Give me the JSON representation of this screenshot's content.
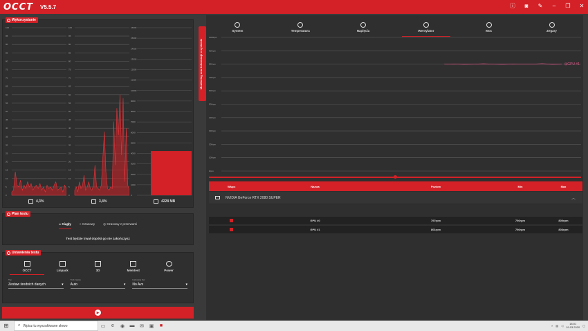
{
  "app": {
    "logo": "OCCT",
    "version": "V5.5.7"
  },
  "titlebar_icons": [
    "info-icon",
    "camera-icon",
    "wrench-icon",
    "minimize-icon",
    "restore-icon",
    "close-icon"
  ],
  "usage_panel": {
    "title": "Wykorzystanie",
    "cpu": {
      "value": "4,3%",
      "axis_ticks": [
        "100",
        "95",
        "90",
        "85",
        "80",
        "75",
        "70",
        "65",
        "60",
        "55",
        "50",
        "45",
        "40",
        "35",
        "30",
        "25",
        "20",
        "15",
        "10",
        "5",
        "0"
      ]
    },
    "gpu": {
      "value": "3,4%",
      "axis_ticks": [
        "100",
        "95",
        "90",
        "85",
        "80",
        "75",
        "70",
        "65",
        "60",
        "55",
        "50",
        "45",
        "40",
        "35",
        "30",
        "25",
        "20",
        "15",
        "10",
        "5",
        "0"
      ]
    },
    "ram": {
      "value": "4228 MB",
      "axis_ticks": [
        "16000",
        "15000",
        "14000",
        "13000",
        "12000",
        "11000",
        "10000",
        "9000",
        "8000",
        "7000",
        "6000",
        "5000",
        "4000",
        "3000",
        "2000",
        "1000",
        "0"
      ]
    }
  },
  "plan_panel": {
    "title": "Plan testu",
    "modes": [
      "Ciągły",
      "Czasowy",
      "Czasowy z przerwami"
    ],
    "active_mode": 0,
    "info": "Test będzie trwał dopóki go nie zakończysz"
  },
  "settings_panel": {
    "title": "Ustawienia testu",
    "tests": [
      "OCCT",
      "Linpack",
      "3D",
      "Memtest",
      "Power"
    ],
    "active_test": 0,
    "fields": [
      {
        "label": "Typ",
        "value": "Zestaw średnich danych"
      },
      {
        "label": "Tryb zapisu",
        "value": "Auto"
      },
      {
        "label": "Instrukcje Set",
        "value": "No Avx"
      }
    ]
  },
  "side_tab": "Monitoring oraz informacje o systemie",
  "monitor": {
    "tabs": [
      "System",
      "Temperatura",
      "Napięcia",
      "Wentylator",
      "Moc",
      "Zegary"
    ],
    "active_tab": 3,
    "legend": "GPU #1",
    "axis_ticks": [
      "1000rpm",
      "900rpm",
      "800rpm",
      "700rpm",
      "600rpm",
      "500rpm",
      "400rpm",
      "300rpm",
      "200rpm",
      "100rpm",
      "0rpm"
    ]
  },
  "chart_data": {
    "type": "line",
    "title": "",
    "xlabel": "",
    "ylabel": "",
    "ylim": [
      0,
      1000
    ],
    "series": [
      {
        "name": "GPU #1",
        "values": [
          800,
          801,
          799,
          800,
          802,
          800,
          799,
          801,
          800,
          800,
          803,
          799,
          800
        ]
      }
    ]
  },
  "table": {
    "headers": [
      "Włącz",
      "Nazwa",
      "Poziom",
      "Min",
      "Max"
    ],
    "group": "NVIDIA GeForce RTX 2080 SUPER",
    "rows": [
      {
        "name": "GPU #0",
        "value": "797rpm",
        "min": "796rpm",
        "max": "800rpm"
      },
      {
        "name": "GPU #1",
        "value": "801rpm",
        "min": "796rpm",
        "max": "804rpm"
      }
    ]
  },
  "taskbar": {
    "search_placeholder": "Wpisz tu wyszukiwane słowo",
    "time": "18:01",
    "date": "19.03.2020"
  },
  "colors": {
    "accent": "#d32127",
    "panel": "#2f2f2f",
    "background": "#3a3a3a"
  }
}
